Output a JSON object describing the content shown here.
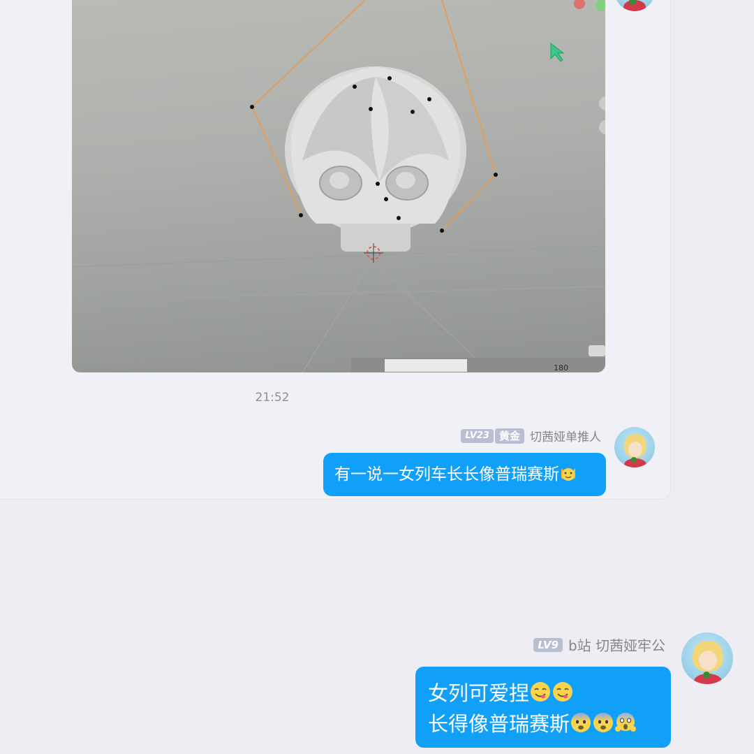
{
  "photo_message": {
    "image_label": "3D model screenshot",
    "timeline_frame": "180"
  },
  "timestamp": "21:52",
  "messages": [
    {
      "level": "LV23",
      "title": "黄金",
      "name": "切茜娅单推人",
      "text": "有一说一女列车长长像普瑞赛斯",
      "emojis": [
        "cat-face-emoji"
      ]
    },
    {
      "level": "LV9",
      "name": "b站 切茜娅牢公",
      "line1": "女列可爱捏",
      "line2": "长得像普瑞赛斯",
      "line1_emojis": [
        "yum-emoji",
        "yum-emoji"
      ],
      "line2_emojis": [
        "fearful-emoji",
        "fearful-emoji",
        "scream-emoji"
      ]
    }
  ],
  "colors": {
    "bubble": "#11a0f7",
    "background": "#ededf3",
    "badge": "#b9bfd2"
  }
}
